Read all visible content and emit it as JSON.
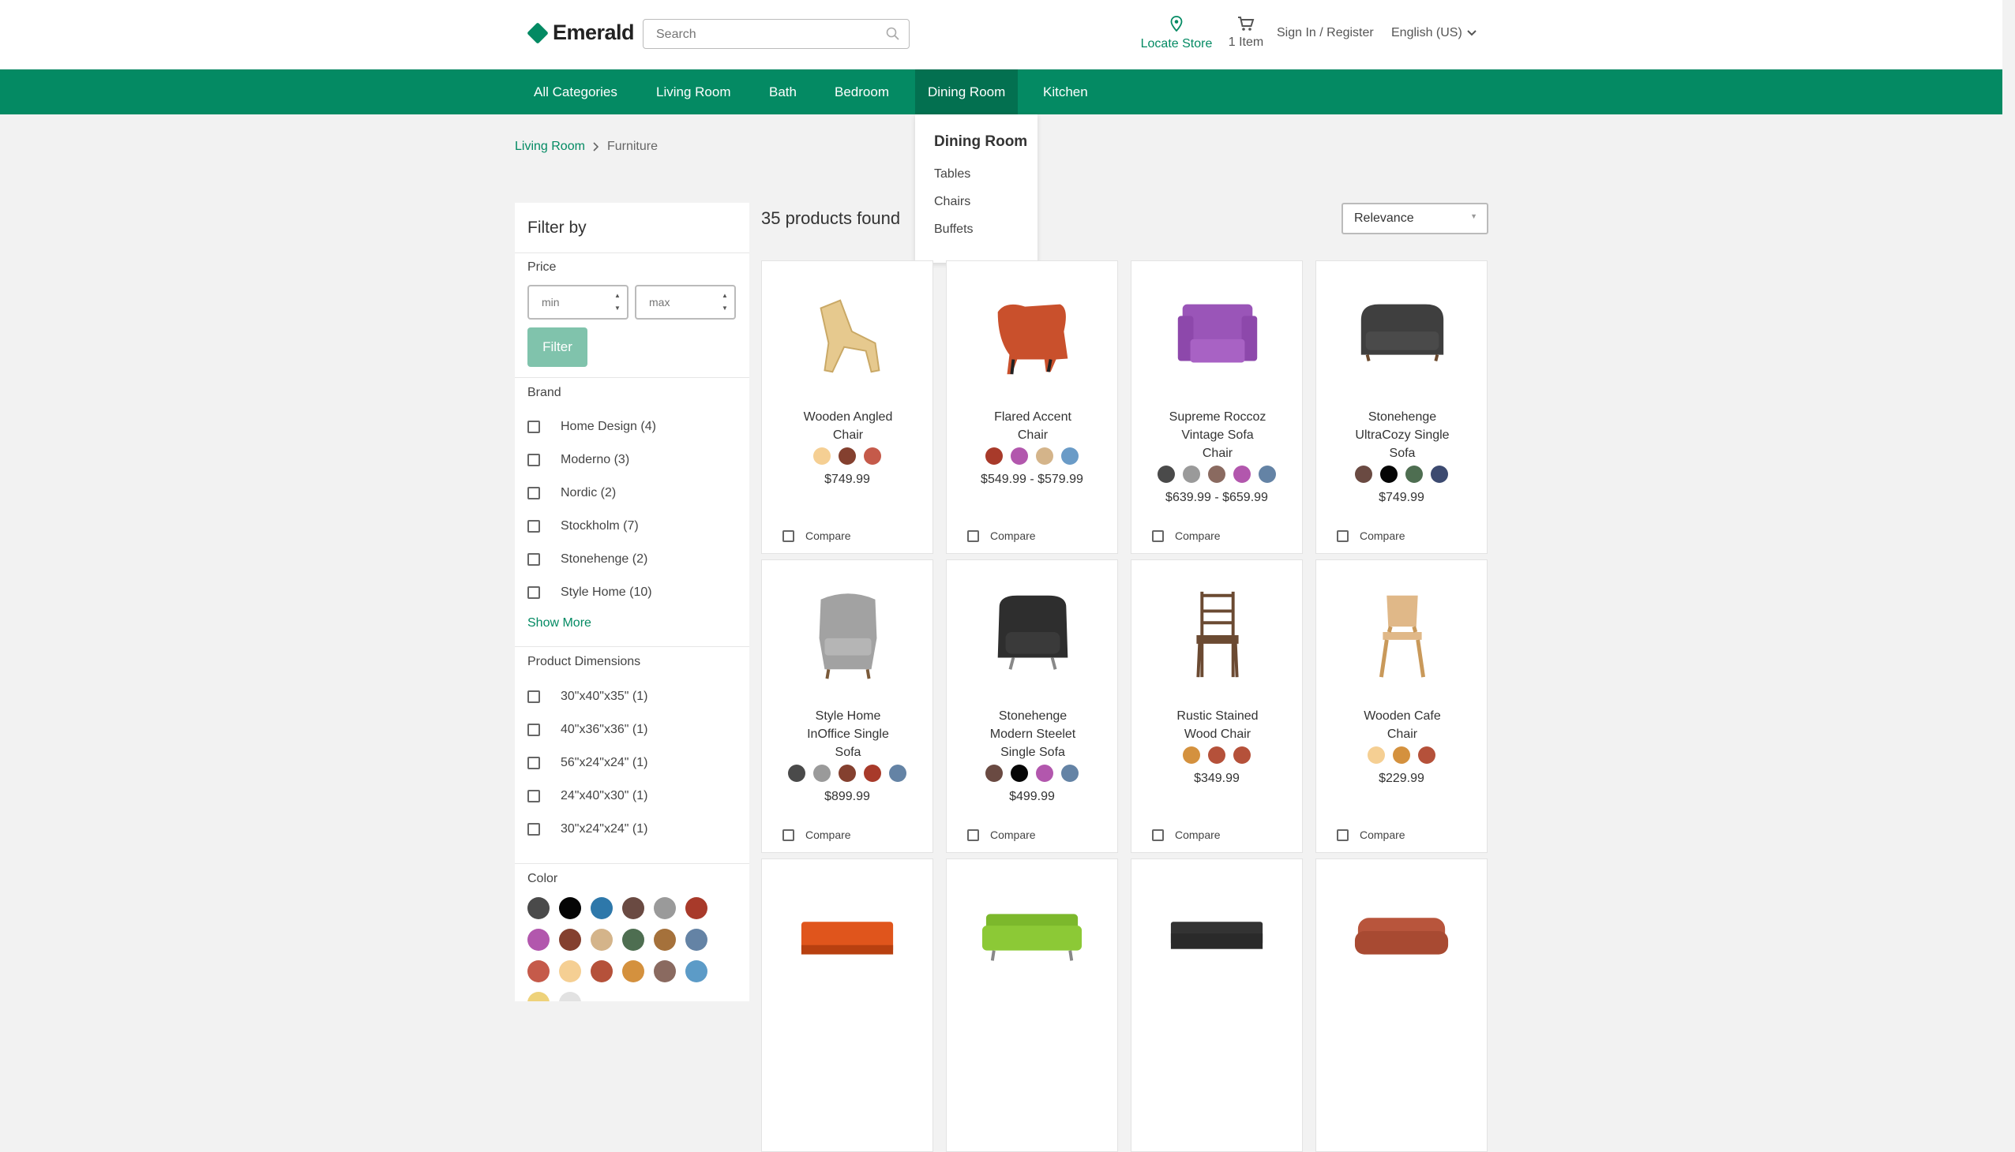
{
  "header": {
    "brand": "Emerald",
    "search_placeholder": "Search",
    "locate_label": "Locate Store",
    "cart_label": "1 Item",
    "signin_label": "Sign In / Register",
    "language_label": "English (US)",
    "accent_color": "#048a63"
  },
  "nav": {
    "items": [
      "All Categories",
      "Living Room",
      "Bath",
      "Bedroom",
      "Dining Room",
      "Kitchen"
    ],
    "active": "Dining Room",
    "dropdown": {
      "title": "Dining Room",
      "items": [
        "Tables",
        "Chairs",
        "Buffets"
      ]
    }
  },
  "breadcrumb": {
    "link": "Living Room",
    "current": "Furniture"
  },
  "sidebar": {
    "title": "Filter by",
    "price": {
      "label": "Price",
      "min_placeholder": "min",
      "max_placeholder": "max",
      "button": "Filter"
    },
    "brand": {
      "label": "Brand",
      "options": [
        "Home Design (4)",
        "Moderno (3)",
        "Nordic (2)",
        "Stockholm (7)",
        "Stonehenge (2)",
        "Style Home (10)"
      ],
      "show_more": "Show More"
    },
    "dimensions": {
      "label": "Product Dimensions",
      "options": [
        "30\"x40\"x35\" (1)",
        "40\"x36\"x36\" (1)",
        "56\"x24\"x24\" (1)",
        "24\"x40\"x30\" (1)",
        "30\"x24\"x24\" (1)"
      ]
    },
    "color": {
      "label": "Color",
      "swatches": [
        "#4a4a4a",
        "#050505",
        "#2e78aa",
        "#6a4a42",
        "#9a9a9a",
        "#a83a2a",
        "#b257ad",
        "#84402f",
        "#d4b48a",
        "#4e6e51",
        "#a5713b",
        "#6483a5",
        "#c55a4a",
        "#f5cf93",
        "#b5513a",
        "#d4913e",
        "#8a6a60",
        "#5c9bc7",
        "#eed27a",
        "#e2e2e2"
      ]
    }
  },
  "results": {
    "count_label": "35 products found",
    "sort_label": "Relevance"
  },
  "products": [
    {
      "name": "Wooden Angled Chair",
      "price": "$749.99",
      "colors": [
        "#f5cf93",
        "#84402f",
        "#c55a4a"
      ],
      "icon": "lounge-chair"
    },
    {
      "name": "Flared Accent Chair",
      "price": "$549.99 - $579.99",
      "colors": [
        "#a83a2a",
        "#b257ad",
        "#d4b48a",
        "#6a9bc7"
      ],
      "icon": "accent-chair"
    },
    {
      "name": "Supreme Roccoz Vintage Sofa Chair",
      "price": "$639.99 - $659.99",
      "colors": [
        "#4a4a4a",
        "#9a9a9a",
        "#8a6a60",
        "#b257ad",
        "#6483a5"
      ],
      "icon": "sofa-chair"
    },
    {
      "name": "Stonehenge UltraCozy Single Sofa",
      "price": "$749.99",
      "colors": [
        "#6a4a42",
        "#050505",
        "#4e6e51",
        "#3c4a70"
      ],
      "icon": "tufted-sofa"
    },
    {
      "name": "Style Home InOffice Single Sofa",
      "price": "$899.99",
      "colors": [
        "#4a4a4a",
        "#9a9a9a",
        "#84402f",
        "#a83a2a",
        "#6483a5"
      ],
      "icon": "wingback-chair"
    },
    {
      "name": "Stonehenge Modern Steelet Single Sofa",
      "price": "$499.99",
      "colors": [
        "#6a4a42",
        "#050505",
        "#b257ad",
        "#6483a5"
      ],
      "icon": "armchair"
    },
    {
      "name": "Rustic Stained Wood Chair",
      "price": "$349.99",
      "colors": [
        "#d4913e",
        "#b5513a",
        "#b5513a"
      ],
      "icon": "wood-chair"
    },
    {
      "name": "Wooden Cafe Chair",
      "price": "$229.99",
      "colors": [
        "#f5cf93",
        "#d4913e",
        "#b5513a"
      ],
      "icon": "cafe-chair"
    },
    {
      "name": "",
      "price": "",
      "colors": [],
      "icon": "orange-sofa"
    },
    {
      "name": "",
      "price": "",
      "colors": [],
      "icon": "green-sofa"
    },
    {
      "name": "",
      "price": "",
      "colors": [],
      "icon": "black-sofa"
    },
    {
      "name": "",
      "price": "",
      "colors": [],
      "icon": "brown-sofa"
    }
  ],
  "compare_label": "Compare"
}
